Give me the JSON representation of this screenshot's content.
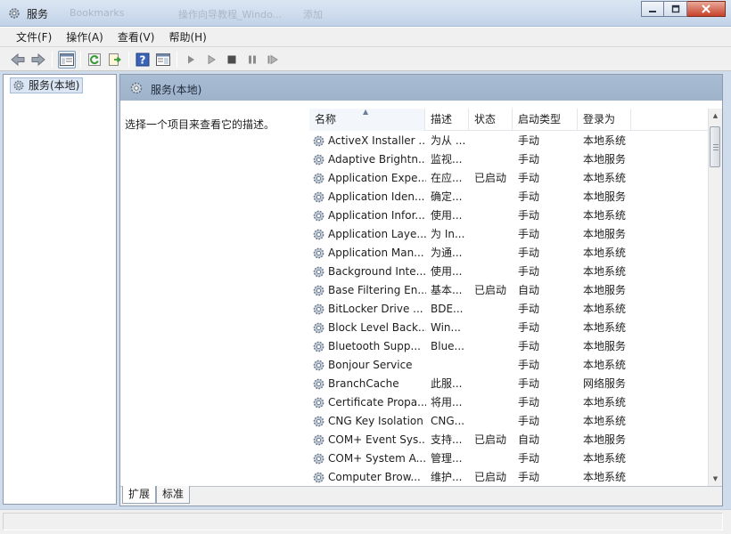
{
  "window": {
    "title": "服务",
    "bg_tabs": [
      "Bookmarks",
      "操作向导教程_Windo...",
      "添加"
    ]
  },
  "menu": [
    {
      "label": "文件(F)"
    },
    {
      "label": "操作(A)"
    },
    {
      "label": "查看(V)"
    },
    {
      "label": "帮助(H)"
    }
  ],
  "tree": {
    "root_label": "服务(本地)"
  },
  "pane": {
    "title": "服务(本地)",
    "description_prompt": "选择一个项目来查看它的描述。"
  },
  "columns": {
    "name": "名称",
    "desc": "描述",
    "status": "状态",
    "startup": "启动类型",
    "logon": "登录为"
  },
  "services": [
    {
      "name": "ActiveX Installer ...",
      "desc": "为从 ...",
      "status": "",
      "startup": "手动",
      "logon": "本地系统"
    },
    {
      "name": "Adaptive Brightn...",
      "desc": "监视...",
      "status": "",
      "startup": "手动",
      "logon": "本地服务"
    },
    {
      "name": "Application Expe...",
      "desc": "在应...",
      "status": "已启动",
      "startup": "手动",
      "logon": "本地系统"
    },
    {
      "name": "Application Iden...",
      "desc": "确定...",
      "status": "",
      "startup": "手动",
      "logon": "本地服务"
    },
    {
      "name": "Application Infor...",
      "desc": "使用...",
      "status": "",
      "startup": "手动",
      "logon": "本地系统"
    },
    {
      "name": "Application Laye...",
      "desc": "为 In...",
      "status": "",
      "startup": "手动",
      "logon": "本地服务"
    },
    {
      "name": "Application Man...",
      "desc": "为通...",
      "status": "",
      "startup": "手动",
      "logon": "本地系统"
    },
    {
      "name": "Background Inte...",
      "desc": "使用...",
      "status": "",
      "startup": "手动",
      "logon": "本地系统"
    },
    {
      "name": "Base Filtering En...",
      "desc": "基本...",
      "status": "已启动",
      "startup": "自动",
      "logon": "本地服务"
    },
    {
      "name": "BitLocker Drive ...",
      "desc": "BDE...",
      "status": "",
      "startup": "手动",
      "logon": "本地系统"
    },
    {
      "name": "Block Level Back...",
      "desc": "Win...",
      "status": "",
      "startup": "手动",
      "logon": "本地系统"
    },
    {
      "name": "Bluetooth Supp...",
      "desc": "Blue...",
      "status": "",
      "startup": "手动",
      "logon": "本地服务"
    },
    {
      "name": "Bonjour Service",
      "desc": "",
      "status": "",
      "startup": "手动",
      "logon": "本地系统"
    },
    {
      "name": "BranchCache",
      "desc": "此服...",
      "status": "",
      "startup": "手动",
      "logon": "网络服务"
    },
    {
      "name": "Certificate Propa...",
      "desc": "将用...",
      "status": "",
      "startup": "手动",
      "logon": "本地系统"
    },
    {
      "name": "CNG Key Isolation",
      "desc": "CNG...",
      "status": "",
      "startup": "手动",
      "logon": "本地系统"
    },
    {
      "name": "COM+ Event Sys...",
      "desc": "支持...",
      "status": "已启动",
      "startup": "自动",
      "logon": "本地服务"
    },
    {
      "name": "COM+ System A...",
      "desc": "管理...",
      "status": "",
      "startup": "手动",
      "logon": "本地系统"
    },
    {
      "name": "Computer Brow...",
      "desc": "维护...",
      "status": "已启动",
      "startup": "手动",
      "logon": "本地系统"
    }
  ],
  "tabs": [
    {
      "label": "扩展"
    },
    {
      "label": "标准"
    }
  ],
  "icons": {
    "service": "gear-icon",
    "back": "back-arrow-icon",
    "forward": "forward-arrow-icon",
    "refresh": "refresh-icon",
    "export": "export-icon",
    "help": "help-icon",
    "play": "play-icon",
    "stop": "stop-icon",
    "pause": "pause-icon",
    "restart": "restart-icon"
  },
  "colors": {
    "header_bg": "#a8bdd4",
    "close_button": "#c7422a",
    "selection": "#dbe6f5"
  }
}
